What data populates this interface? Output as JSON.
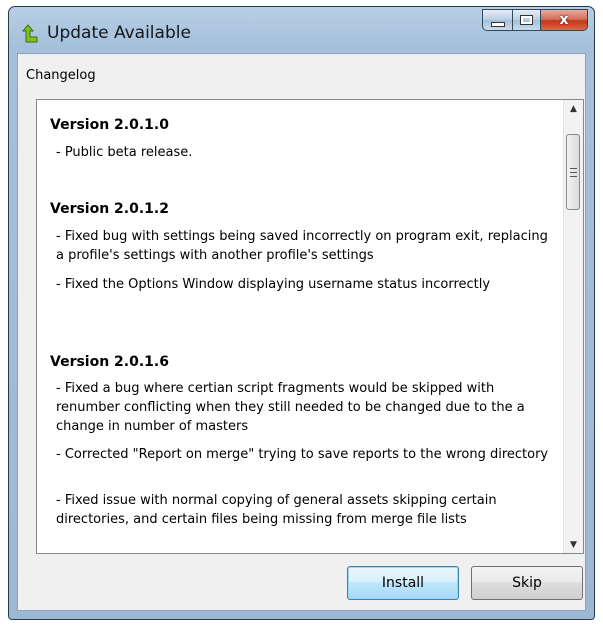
{
  "window": {
    "title": "Update Available"
  },
  "caption_buttons": {
    "close_label": "x"
  },
  "changelog": {
    "label": "Changelog",
    "versions": [
      {
        "version": "Version 2.0.1.0",
        "entries": [
          "- Public beta release."
        ]
      },
      {
        "version": "Version 2.0.1.2",
        "entries": [
          "- Fixed bug with settings being saved incorrectly on program exit, replacing a profile's settings with another profile's settings",
          "- Fixed the Options Window displaying username status incorrectly"
        ]
      },
      {
        "version": "Version 2.0.1.6",
        "entries": [
          "- Fixed a bug where certian script fragments would be skipped with renumber conflicting when they still needed to be changed due to the a change in number of masters",
          "- Corrected \"Report on merge\" trying to save reports to the wrong directory",
          "- Fixed issue with normal copying of general assets skipping certain directories, and certain files being missing from merge file lists"
        ]
      }
    ]
  },
  "buttons": {
    "install": "Install",
    "skip": "Skip"
  },
  "colors": {
    "frame": "#a6c0db",
    "close": "#c2381a",
    "default_button": "#3c7fb1"
  }
}
